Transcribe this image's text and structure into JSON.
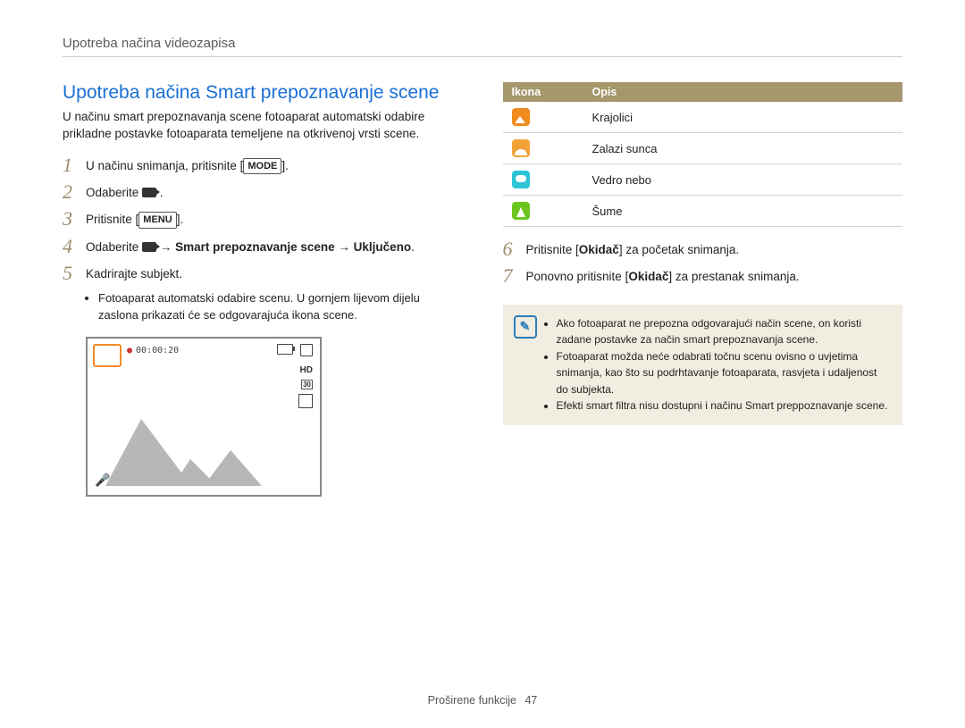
{
  "chapter": "Upotreba načina videozapisa",
  "title": "Upotreba načina Smart prepoznavanje scene",
  "intro": "U načinu smart prepoznavanja scene fotoaparat automatski odabire prikladne postavke fotoaparata temeljene na otkrivenoj vrsti scene.",
  "btn": {
    "mode": "MODE",
    "menu": "MENU"
  },
  "steps": {
    "s1_a": "U načinu snimanja, pritisnite ",
    "s1_b": ".",
    "s2_a": "Odaberite ",
    "s2_b": " .",
    "s3_a": "Pritisnite ",
    "s3_b": ".",
    "s4_a": "Odaberite ",
    "s4_arrow": " → ",
    "s4_bold1": "Smart prepoznavanje scene",
    "s4_bold2": "Uključeno",
    "s4_end": ".",
    "s5": "Kadrirajte subjekt.",
    "s5_sub": "Fotoaparat automatski odabire scenu. U gornjem lijevom dijelu zaslona prikazati će se odgovarajuća ikona scene.",
    "s6_a": "Pritisnite [",
    "s6_bold": "Okidač",
    "s6_b": "] za početak snimanja.",
    "s7_a": "Ponovno pritisnite [",
    "s7_bold": "Okidač",
    "s7_b": "] za prestanak snimanja."
  },
  "lcd": {
    "time": "00:00:20",
    "hd": "HD",
    "fps": "30"
  },
  "table": {
    "h1": "Ikona",
    "h2": "Opis",
    "rows": [
      {
        "icon": "land",
        "label": "Krajolici"
      },
      {
        "icon": "sun",
        "label": "Zalazi sunca"
      },
      {
        "icon": "sky",
        "label": "Vedro nebo"
      },
      {
        "icon": "for",
        "label": "Šume"
      }
    ]
  },
  "notes": [
    "Ako fotoaparat ne prepozna odgovarajući način scene, on koristi zadane postavke za način smart prepoznavanja scene.",
    "Fotoaparat možda neće odabrati točnu scenu ovisno o uvjetima snimanja, kao što su podrhtavanje fotoaparata, rasvjeta i udaljenost do subjekta.",
    "Efekti smart filtra nisu dostupni i načinu Smart preppoznavanje scene."
  ],
  "footer": {
    "section": "Proširene funkcije",
    "page": "47"
  }
}
